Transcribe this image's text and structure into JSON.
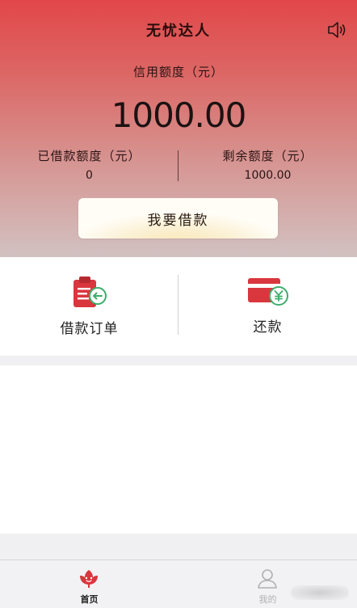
{
  "header": {
    "title": "无忧达人",
    "sound_icon": "speaker-icon"
  },
  "credit": {
    "label": "信用额度（元）",
    "amount": "1000.00"
  },
  "stats": {
    "borrowed_label": "已借款额度（元）",
    "borrowed_value": "0",
    "remaining_label": "剩余额度（元）",
    "remaining_value": "1000.00"
  },
  "borrow_button": {
    "label": "我要借款"
  },
  "actions": [
    {
      "label": "借款订单",
      "icon": "clipboard-order-icon"
    },
    {
      "label": "还款",
      "icon": "card-yuan-icon"
    }
  ],
  "tabbar": [
    {
      "label": "首页",
      "icon": "flower-home-icon",
      "active": true
    },
    {
      "label": "我的",
      "icon": "person-icon",
      "active": false
    }
  ],
  "colors": {
    "brand_red": "#e2474a",
    "icon_red": "#d9363e",
    "icon_green": "#3cae6a"
  }
}
